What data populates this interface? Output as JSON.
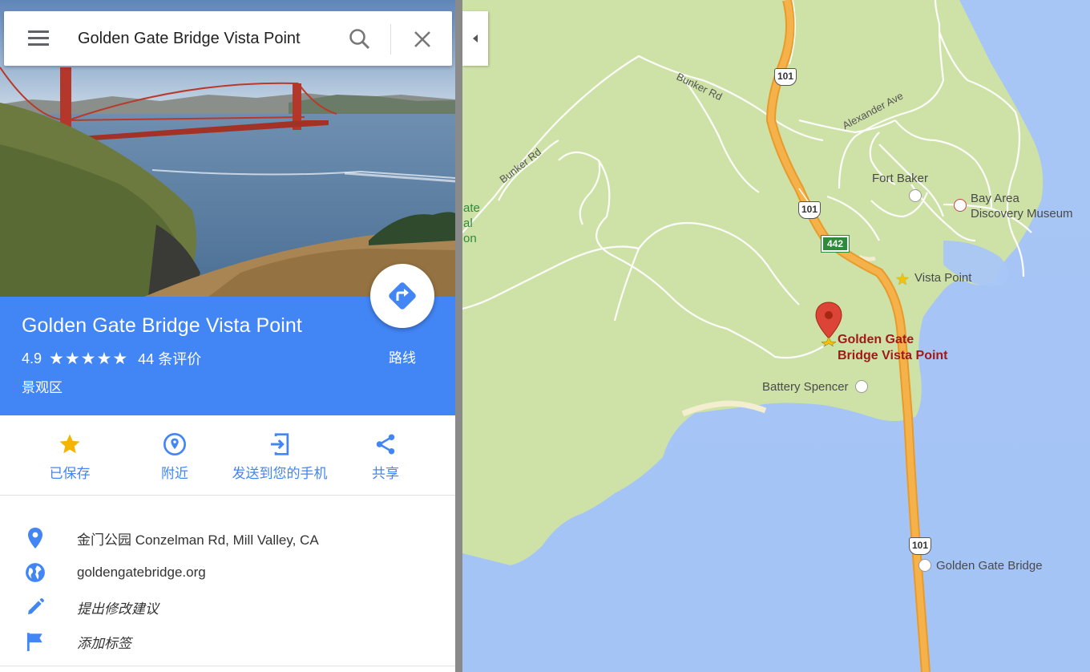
{
  "search": {
    "query": "Golden Gate Bridge Vista Point"
  },
  "place": {
    "title": "Golden Gate Bridge Vista Point",
    "rating": "4.9",
    "stars": "★★★★★",
    "reviews": "44 条评价",
    "category": "景观区",
    "directions_label": "路线"
  },
  "actions": [
    {
      "label": "已保存",
      "icon": "star-icon"
    },
    {
      "label": "附近",
      "icon": "nearby-icon"
    },
    {
      "label": "发送到您的手机",
      "icon": "send-to-phone-icon"
    },
    {
      "label": "共享",
      "icon": "share-icon"
    }
  ],
  "info": {
    "address": "金门公园 Conzelman Rd, Mill Valley, CA",
    "website": "goldengatebridge.org",
    "suggest_edit": "提出修改建议",
    "add_label": "添加标签"
  },
  "map": {
    "labels": {
      "fort_baker": "Fort Baker",
      "bay_area_museum_1": "Bay Area",
      "bay_area_museum_2": "Discovery Museum",
      "vista_point": "Vista Point",
      "battery_spencer": "Battery Spencer",
      "golden_gate_bridge": "Golden Gate Bridge",
      "selected_1": "Golden Gate",
      "selected_2": "Bridge Vista Point",
      "park_partial_1": "ate",
      "park_partial_2": "al",
      "park_partial_3": "on"
    },
    "roads": {
      "bunker_rd_1": "Bunker Rd",
      "bunker_rd_2": "Bunker Rd",
      "alexander_ave": "Alexander Ave"
    },
    "shields": {
      "us101_a": "101",
      "us101_b": "101",
      "us101_c": "101",
      "ca442": "442"
    }
  },
  "colors": {
    "accent": "#4285f4",
    "land": "#cfe2a8",
    "water": "#a8c8f8",
    "highway": "#f4a533",
    "pin": "#db4437"
  }
}
